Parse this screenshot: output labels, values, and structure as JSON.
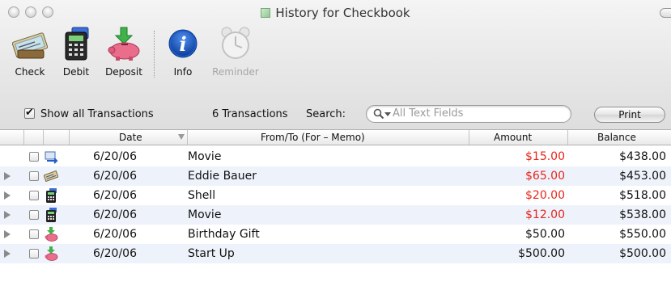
{
  "window": {
    "title": "History for Checkbook"
  },
  "toolbar": {
    "check_label": "Check",
    "debit_label": "Debit",
    "deposit_label": "Deposit",
    "info_label": "Info",
    "reminder_label": "Reminder"
  },
  "filter": {
    "show_all_label": "Show all Transactions",
    "show_all_checked": true,
    "count_text": "6 Transactions",
    "search_label": "Search:",
    "search_placeholder": "All Text Fields",
    "print_label": "Print"
  },
  "table": {
    "columns": {
      "date": "Date",
      "payee": "From/To  (For – Memo)",
      "amount": "Amount",
      "balance": "Balance"
    },
    "rows": [
      {
        "icon": "transfer-icon",
        "date": "6/20/06",
        "payee": "Movie",
        "amount": "$15.00",
        "debit": true,
        "balance": "$438.00",
        "expandable": false
      },
      {
        "icon": "check-icon",
        "date": "6/20/06",
        "payee": "Eddie Bauer",
        "amount": "$65.00",
        "debit": true,
        "balance": "$453.00",
        "expandable": true
      },
      {
        "icon": "debit-card-icon",
        "date": "6/20/06",
        "payee": "Shell",
        "amount": "$20.00",
        "debit": true,
        "balance": "$518.00",
        "expandable": true
      },
      {
        "icon": "debit-card-icon",
        "date": "6/20/06",
        "payee": "Movie",
        "amount": "$12.00",
        "debit": true,
        "balance": "$538.00",
        "expandable": true
      },
      {
        "icon": "deposit-icon",
        "date": "6/20/06",
        "payee": "Birthday Gift",
        "amount": "$50.00",
        "debit": false,
        "balance": "$550.00",
        "expandable": true
      },
      {
        "icon": "deposit-icon",
        "date": "6/20/06",
        "payee": "Start Up",
        "amount": "$500.00",
        "debit": false,
        "balance": "$500.00",
        "expandable": true
      }
    ]
  },
  "colors": {
    "debit_amount": "#e8241a",
    "row_alt": "#eef3fb",
    "info_blue": "#1d5fcf"
  }
}
